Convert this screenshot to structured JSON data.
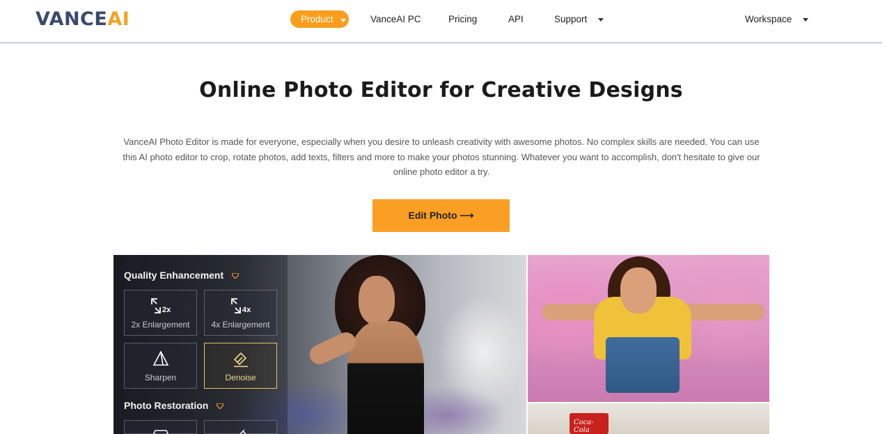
{
  "header": {
    "logo": {
      "part1": "VANCE",
      "part2": "AI"
    },
    "nav": [
      {
        "label": "Product",
        "has_caret": true,
        "active": true
      },
      {
        "label": "VanceAI PC",
        "has_caret": false
      },
      {
        "label": "Pricing",
        "has_caret": false
      },
      {
        "label": "API",
        "has_caret": false
      },
      {
        "label": "Support",
        "has_caret": true
      }
    ],
    "workspace_label": "Workspace"
  },
  "hero": {
    "title": "Online Photo Editor for Creative Designs",
    "description": "VanceAI Photo Editor is made for everyone, especially when you desire to unleash creativity with awesome photos. No complex skills are needed. You can use this AI photo editor to crop, rotate photos, add texts, filters and more to make your photos stunning. Whatever you want to accomplish, don't hesitate to give our online photo editor a try.",
    "cta_label": "Edit Photo ⟶"
  },
  "showcase": {
    "quality_section_label": "Quality Enhancement",
    "restoration_section_label": "Photo Restoration",
    "tools": [
      {
        "label": "2x Enlargement",
        "icon": "enlarge-2x-icon",
        "icon_text": "2x"
      },
      {
        "label": "4x Enlargement",
        "icon": "enlarge-4x-icon",
        "icon_text": "4x"
      },
      {
        "label": "Sharpen",
        "icon": "sharpen-icon"
      },
      {
        "label": "Denoise",
        "icon": "denoise-icon",
        "active": true
      }
    ],
    "can_text": "Coca-Cola"
  },
  "colors": {
    "accent": "#f99e1c",
    "cta": "#fb9e24",
    "logo_dark": "#3b4a6b",
    "logo_accent": "#f4a223",
    "active_tool_border": "#e8c75a"
  }
}
